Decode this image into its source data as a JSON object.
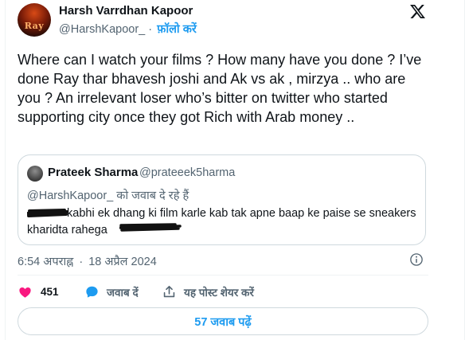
{
  "tweet": {
    "author": {
      "display_name": "Harsh Varrdhan Kapoor",
      "handle": "@HarshKapoor_",
      "separator": "·",
      "follow_label": "फ़ॉलो करें",
      "avatar_text": "Ray"
    },
    "text": "Where can I watch your films ? How many have you done ? I’ve done Ray thar bhavesh joshi and Ak vs ak , mirzya .. who are you ? An irrelevant loser who’s bitter on twitter who started supporting city once they got Rich with Arab money ..",
    "time": "6:54 अपराह्न",
    "date": "18 अप्रैल 2024",
    "meta_separator": "·"
  },
  "quoted": {
    "display_name": "Prateek Sharma",
    "handle": "@prateeek5harma",
    "replying_to": "@HarshKapoor_ को जवाब दे रहे हैं",
    "line1": "kabhi ek dhang ki film karle kab tak apne baap ke paise se sneakers",
    "line2": "kharidta rahega"
  },
  "actions": {
    "likes": "451",
    "reply_label": "जवाब दें",
    "share_label": "यह पोस्ट शेयर करें"
  },
  "replies_button": "57 जवाब पढ़ें",
  "icons": {
    "logo": "x-logo-icon",
    "info": "info-icon",
    "like": "heart-icon",
    "reply": "reply-bubble-icon",
    "share": "share-icon"
  },
  "colors": {
    "accent": "#1d9bf0",
    "like": "#f91880",
    "secondary_text": "#536471",
    "border": "#cfd9de"
  }
}
